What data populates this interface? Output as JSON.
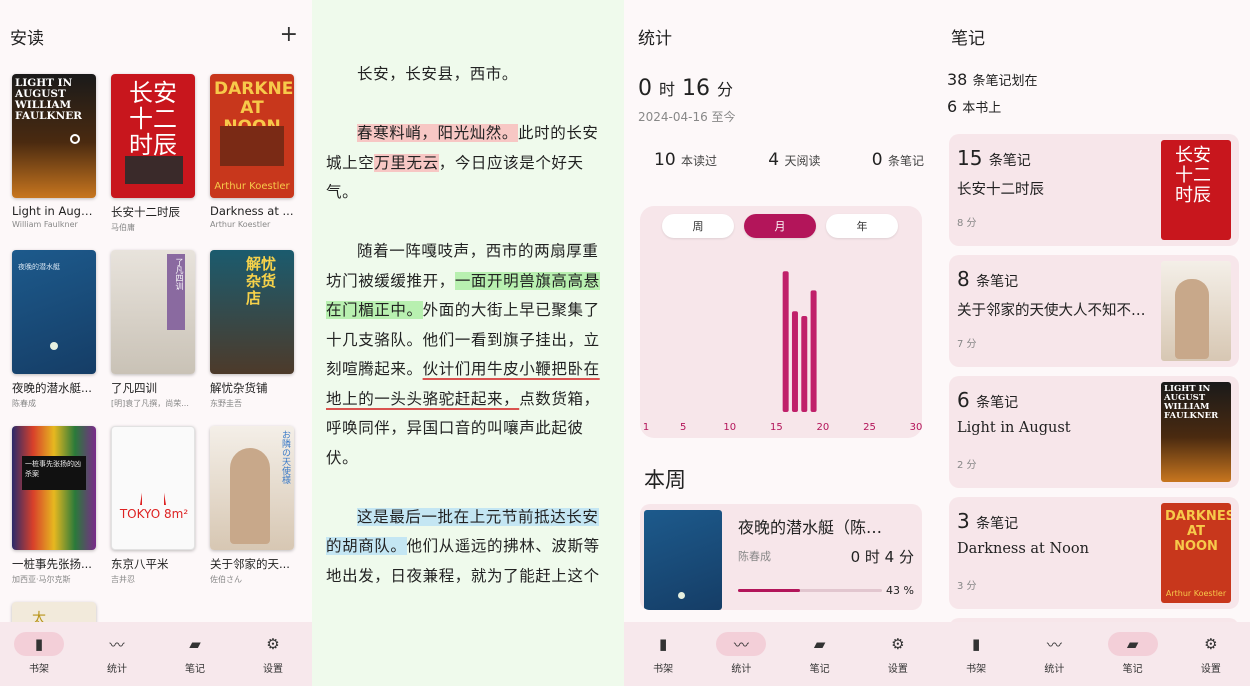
{
  "shelf": {
    "title": "安读",
    "add": "+",
    "books": [
      {
        "title": "Light in August",
        "author": "William Faulkner",
        "cover_text": "LIGHT IN AUGUST WILLIAM FAULKNER"
      },
      {
        "title": "长安十二时辰",
        "author": "马伯庸",
        "cover_text": "长安十二时辰"
      },
      {
        "title": "Darkness at ...",
        "author": "Arthur Koestler",
        "cover_text": "DARKNESS AT NOON",
        "cover_sub": "Arthur Koestler"
      },
      {
        "title": "夜晚的潜水艇...",
        "author": "陈春成",
        "cover_text": "夜晚的潜水艇"
      },
      {
        "title": "了凡四训",
        "author": "[明]袁了凡撰，尚荣...",
        "cover_text": "了凡四训"
      },
      {
        "title": "解忧杂货铺",
        "author": "东野圭吾",
        "cover_text": "解忧杂货店"
      },
      {
        "title": "一桩事先张扬...",
        "author": "加西亚·马尔克斯",
        "cover_text": "一桩事先张扬的凶杀案"
      },
      {
        "title": "东京八平米",
        "author": "吉井忍",
        "cover_text": "TOKYO 8m²"
      },
      {
        "title": "关于邻家的天...",
        "author": "佐伯さん",
        "cover_text": "お隣の天使様"
      }
    ],
    "partial_cover_text": "太"
  },
  "nav": [
    "书架",
    "统计",
    "笔记",
    "设置"
  ],
  "reader": {
    "p1": "长安，长安县，西市。",
    "p2a": "春寒料峭，阳光灿然。",
    "p2b": "此时的长安城上空",
    "p2c": "万里无云",
    "p2d": "，今日应该是个好天气。",
    "p3a": "随着一阵嘎吱声，西市的两扇厚重坊门被缓缓推开，",
    "p3b": "一面开明兽旗高高悬在门楣正中。",
    "p3c": "外面的大街上早已聚集了十几支骆队。他们一看到旗子挂出，立刻喧腾起来。",
    "p3d": "伙计们用牛皮小鞭把卧在地上的一头头骆驼赶起来，",
    "p3e": "点数货箱，呼唤同伴，异国口音的叫嚷声此起彼伏。",
    "p4a": "这是最后一批在上元节前抵达长安的胡商队。",
    "p4b": "他们从遥远的拂林、波斯等地出发，日夜兼程，就为了能赶上这个"
  },
  "stats": {
    "title": "统计",
    "hours": "0",
    "h_unit": "时",
    "minutes": "16",
    "m_unit": "分",
    "since": "2024-04-16 至今",
    "read_count": "10",
    "read_label": "本读过",
    "days": "4",
    "days_label": "天阅读",
    "notes": "0",
    "notes_label": "条笔记",
    "tabs": [
      "周",
      "月",
      "年"
    ],
    "active_tab": "月",
    "week_title": "本周",
    "week_book": {
      "title": "夜晚的潜水艇（陈…",
      "author": "陈春成",
      "time": "0 时 4 分",
      "progress_label": "43 %",
      "progress": 0.43
    }
  },
  "chart_data": {
    "type": "bar",
    "x_ticks": [
      "1",
      "5",
      "10",
      "15",
      "20",
      "25",
      "30"
    ],
    "xlim": [
      1,
      30
    ],
    "ylim": [
      0,
      1
    ],
    "bars": [
      {
        "day": 16,
        "value": 0.88
      },
      {
        "day": 17,
        "value": 0.63
      },
      {
        "day": 18,
        "value": 0.6
      },
      {
        "day": 19,
        "value": 0.76
      }
    ],
    "color": "#c0206a"
  },
  "notes": {
    "title": "笔记",
    "total": "38",
    "total_label": "条笔记划在",
    "books_count": "6",
    "books_label": "本书上",
    "items": [
      {
        "count": "15",
        "label": "条笔记",
        "title": "长安十二时辰",
        "time": "8 分"
      },
      {
        "count": "8",
        "label": "条笔记",
        "title": "关于邻家的天使大人不知不觉…",
        "time": "7 分"
      },
      {
        "count": "6",
        "label": "条笔记",
        "title": "Light in August",
        "time": "2 分"
      },
      {
        "count": "3",
        "label": "条笔记",
        "title": "Darkness at Noon",
        "time": "3 分"
      }
    ]
  },
  "colors": {
    "accent": "#b3155a",
    "nav_bg": "#f7e8ec",
    "card_bg": "#f7e6ea"
  }
}
